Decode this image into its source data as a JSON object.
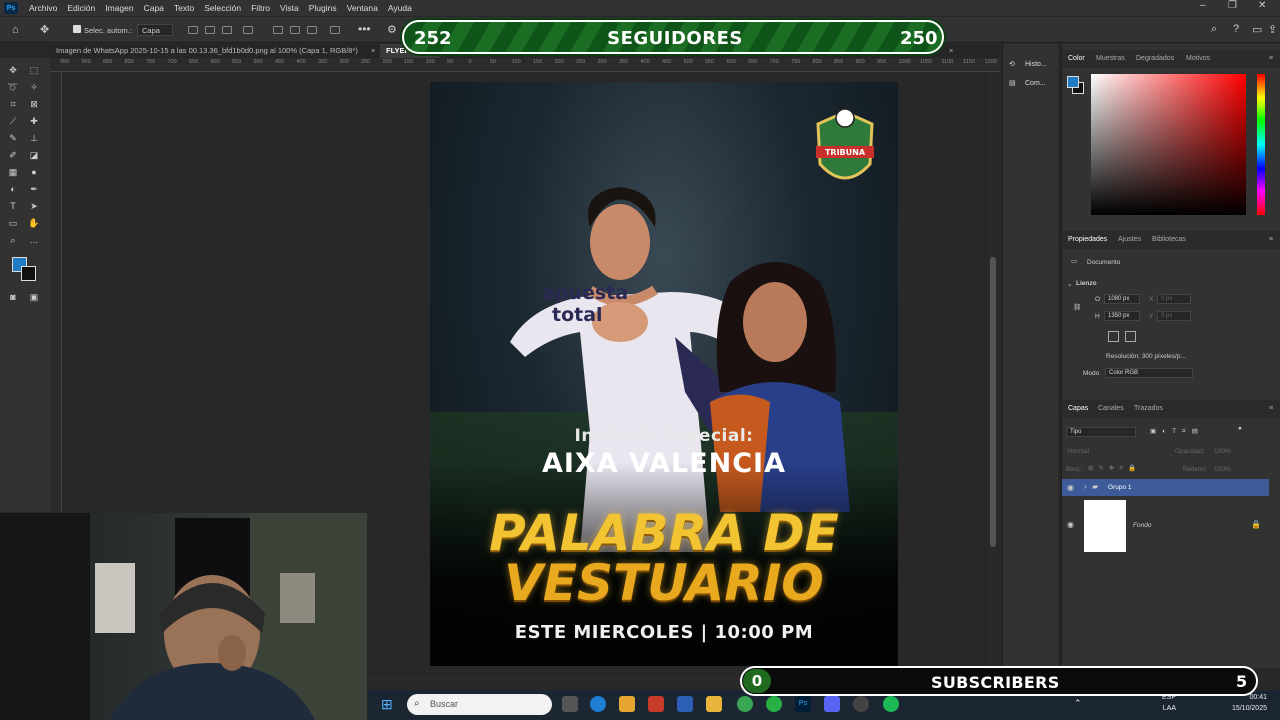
{
  "menubar": {
    "logo": "Ps",
    "items": [
      "Archivo",
      "Edición",
      "Imagen",
      "Capa",
      "Texto",
      "Selección",
      "Filtro",
      "Vista",
      "Plugins",
      "Ventana",
      "Ayuda"
    ]
  },
  "options_bar": {
    "auto_select_label": "Selec. autom.:",
    "auto_select_value": "Capa"
  },
  "tabs": [
    {
      "label": "Imagen de WhatsApp 2025-10-15 a las 00.13.36_bfd1b0d0.png al 100% (Capa 1, RGB/8*)",
      "close": "×"
    },
    {
      "label": "FLYER",
      "close": "×"
    }
  ],
  "ruler_ticks": [
    "950",
    "900",
    "850",
    "800",
    "750",
    "700",
    "650",
    "600",
    "550",
    "500",
    "450",
    "400",
    "350",
    "300",
    "250",
    "200",
    "150",
    "100",
    "50",
    "0",
    "50",
    "100",
    "150",
    "200",
    "250",
    "300",
    "350",
    "400",
    "450",
    "500",
    "550",
    "600",
    "650",
    "700",
    "750",
    "800",
    "850",
    "900",
    "950",
    "1000",
    "1050",
    "1100",
    "1150",
    "1200",
    "1230"
  ],
  "poster": {
    "badge_text": "TRIBUNA",
    "shirt_text_1": "apuesta",
    "shirt_text_2": "total",
    "guest_label": "Invitada Especial:",
    "guest_name": "AIXA VALENCIA",
    "title_line_1": "PALABRA DE",
    "title_line_2": "VESTUARIO",
    "date_line": "ESTE MIERCOLES | 10:00 PM"
  },
  "overlay": {
    "followers_current": "252",
    "followers_label": "SEGUIDORES",
    "followers_goal": "250",
    "subs_current": "0",
    "subs_label": "SUBSCRIBERS",
    "subs_goal": "5"
  },
  "collapsed_panel": {
    "history": "Histo...",
    "comments": "Com..."
  },
  "color_panel": {
    "tabs": [
      "Color",
      "Muestras",
      "Degradados",
      "Motivos"
    ],
    "foreground": "#1e7bc4",
    "background": "#111111"
  },
  "properties_panel": {
    "tabs": [
      "Propiedades",
      "Ajustes",
      "Bibliotecas"
    ],
    "section": "Documento",
    "canvas_label": "Lienzo",
    "width_label": "O",
    "width_value": "1080 px",
    "x_label": "X",
    "x_value": "0 px",
    "height_label": "H",
    "height_value": "1350 px",
    "y_label": "Y",
    "y_value": "0 px",
    "resolution": "Resolución: 300 píxeles/p...",
    "mode_label": "Modo",
    "mode_value": "Color RGB"
  },
  "layers_panel": {
    "tabs": [
      "Capas",
      "Canales",
      "Trazados"
    ],
    "filter_label": "Tipo",
    "blend_mode": "Normal",
    "opacity_label": "Opacidad:",
    "opacity_value": "100%",
    "lock_label": "Bloq.:",
    "fill_label": "Relleno:",
    "fill_value": "100%",
    "layers": [
      {
        "name": "Grupo 1",
        "type": "group",
        "selected": true
      },
      {
        "name": "Fondo",
        "type": "background",
        "locked": true
      }
    ]
  },
  "taskbar": {
    "search_placeholder": "Buscar",
    "lang_1": "ESP",
    "lang_2": "LAA",
    "time": "00:41",
    "date": "15/10/2025"
  }
}
